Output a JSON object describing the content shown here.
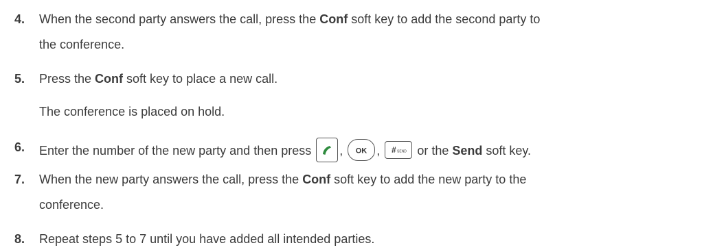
{
  "steps": [
    {
      "number": "4.",
      "line1_pre": "When the second party answers the call, press the ",
      "line1_bold": "Conf",
      "line1_post": " soft key to add the second party to",
      "line2": "the conference."
    },
    {
      "number": "5.",
      "pre": "Press the ",
      "bold": "Conf",
      "post": " soft key to place a new call.",
      "note": "The conference is placed on hold."
    },
    {
      "number": "6.",
      "pre": "Enter the number of the new party and then press ",
      "sep1": ",",
      "sep2": ",",
      "mid": " or the ",
      "bold": "Send",
      "post": " soft key.",
      "keys": {
        "ok_label": "OK",
        "hash_label": "#",
        "hash_sub": "SEND",
        "handset_color": "#2e8b3e"
      }
    },
    {
      "number": "7.",
      "line1_pre": "When the new party answers the call, press the ",
      "line1_bold": "Conf",
      "line1_post": " soft key to add the new party to the",
      "line2": "conference."
    },
    {
      "number": "8.",
      "text": "Repeat steps 5 to 7 until you have added all intended parties."
    }
  ]
}
